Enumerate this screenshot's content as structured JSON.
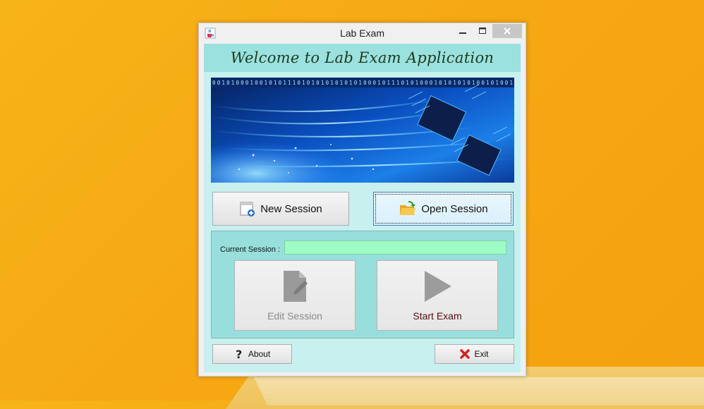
{
  "window": {
    "title": "Lab Exam",
    "close_label": "✕",
    "minimize_label": "─",
    "maximize_label": "☐"
  },
  "banner": {
    "text": "Welcome to Lab Exam Application"
  },
  "hero": {
    "binary_text": "0010100010010101110101010101010100010111010100010101010100101001"
  },
  "buttons": {
    "new_session": "New Session",
    "open_session": "Open Session",
    "edit_session": "Edit Session",
    "start_exam": "Start Exam",
    "about": "About",
    "exit": "Exit"
  },
  "session": {
    "label": "Current Session :",
    "value": ""
  },
  "colors": {
    "desktop": "#f6a813",
    "client": "#c8f0ef",
    "banner": "#9be1df",
    "panel": "#98dedc",
    "field": "#9cfcc4",
    "start_text": "#5a0b0b"
  },
  "icons": {
    "app": "java-cup-icon",
    "new_session": "new-document-plus-icon",
    "open_session": "open-folder-icon",
    "edit_session": "document-pen-icon",
    "start_exam": "play-icon",
    "about": "question-mark-icon",
    "exit": "red-x-icon"
  }
}
